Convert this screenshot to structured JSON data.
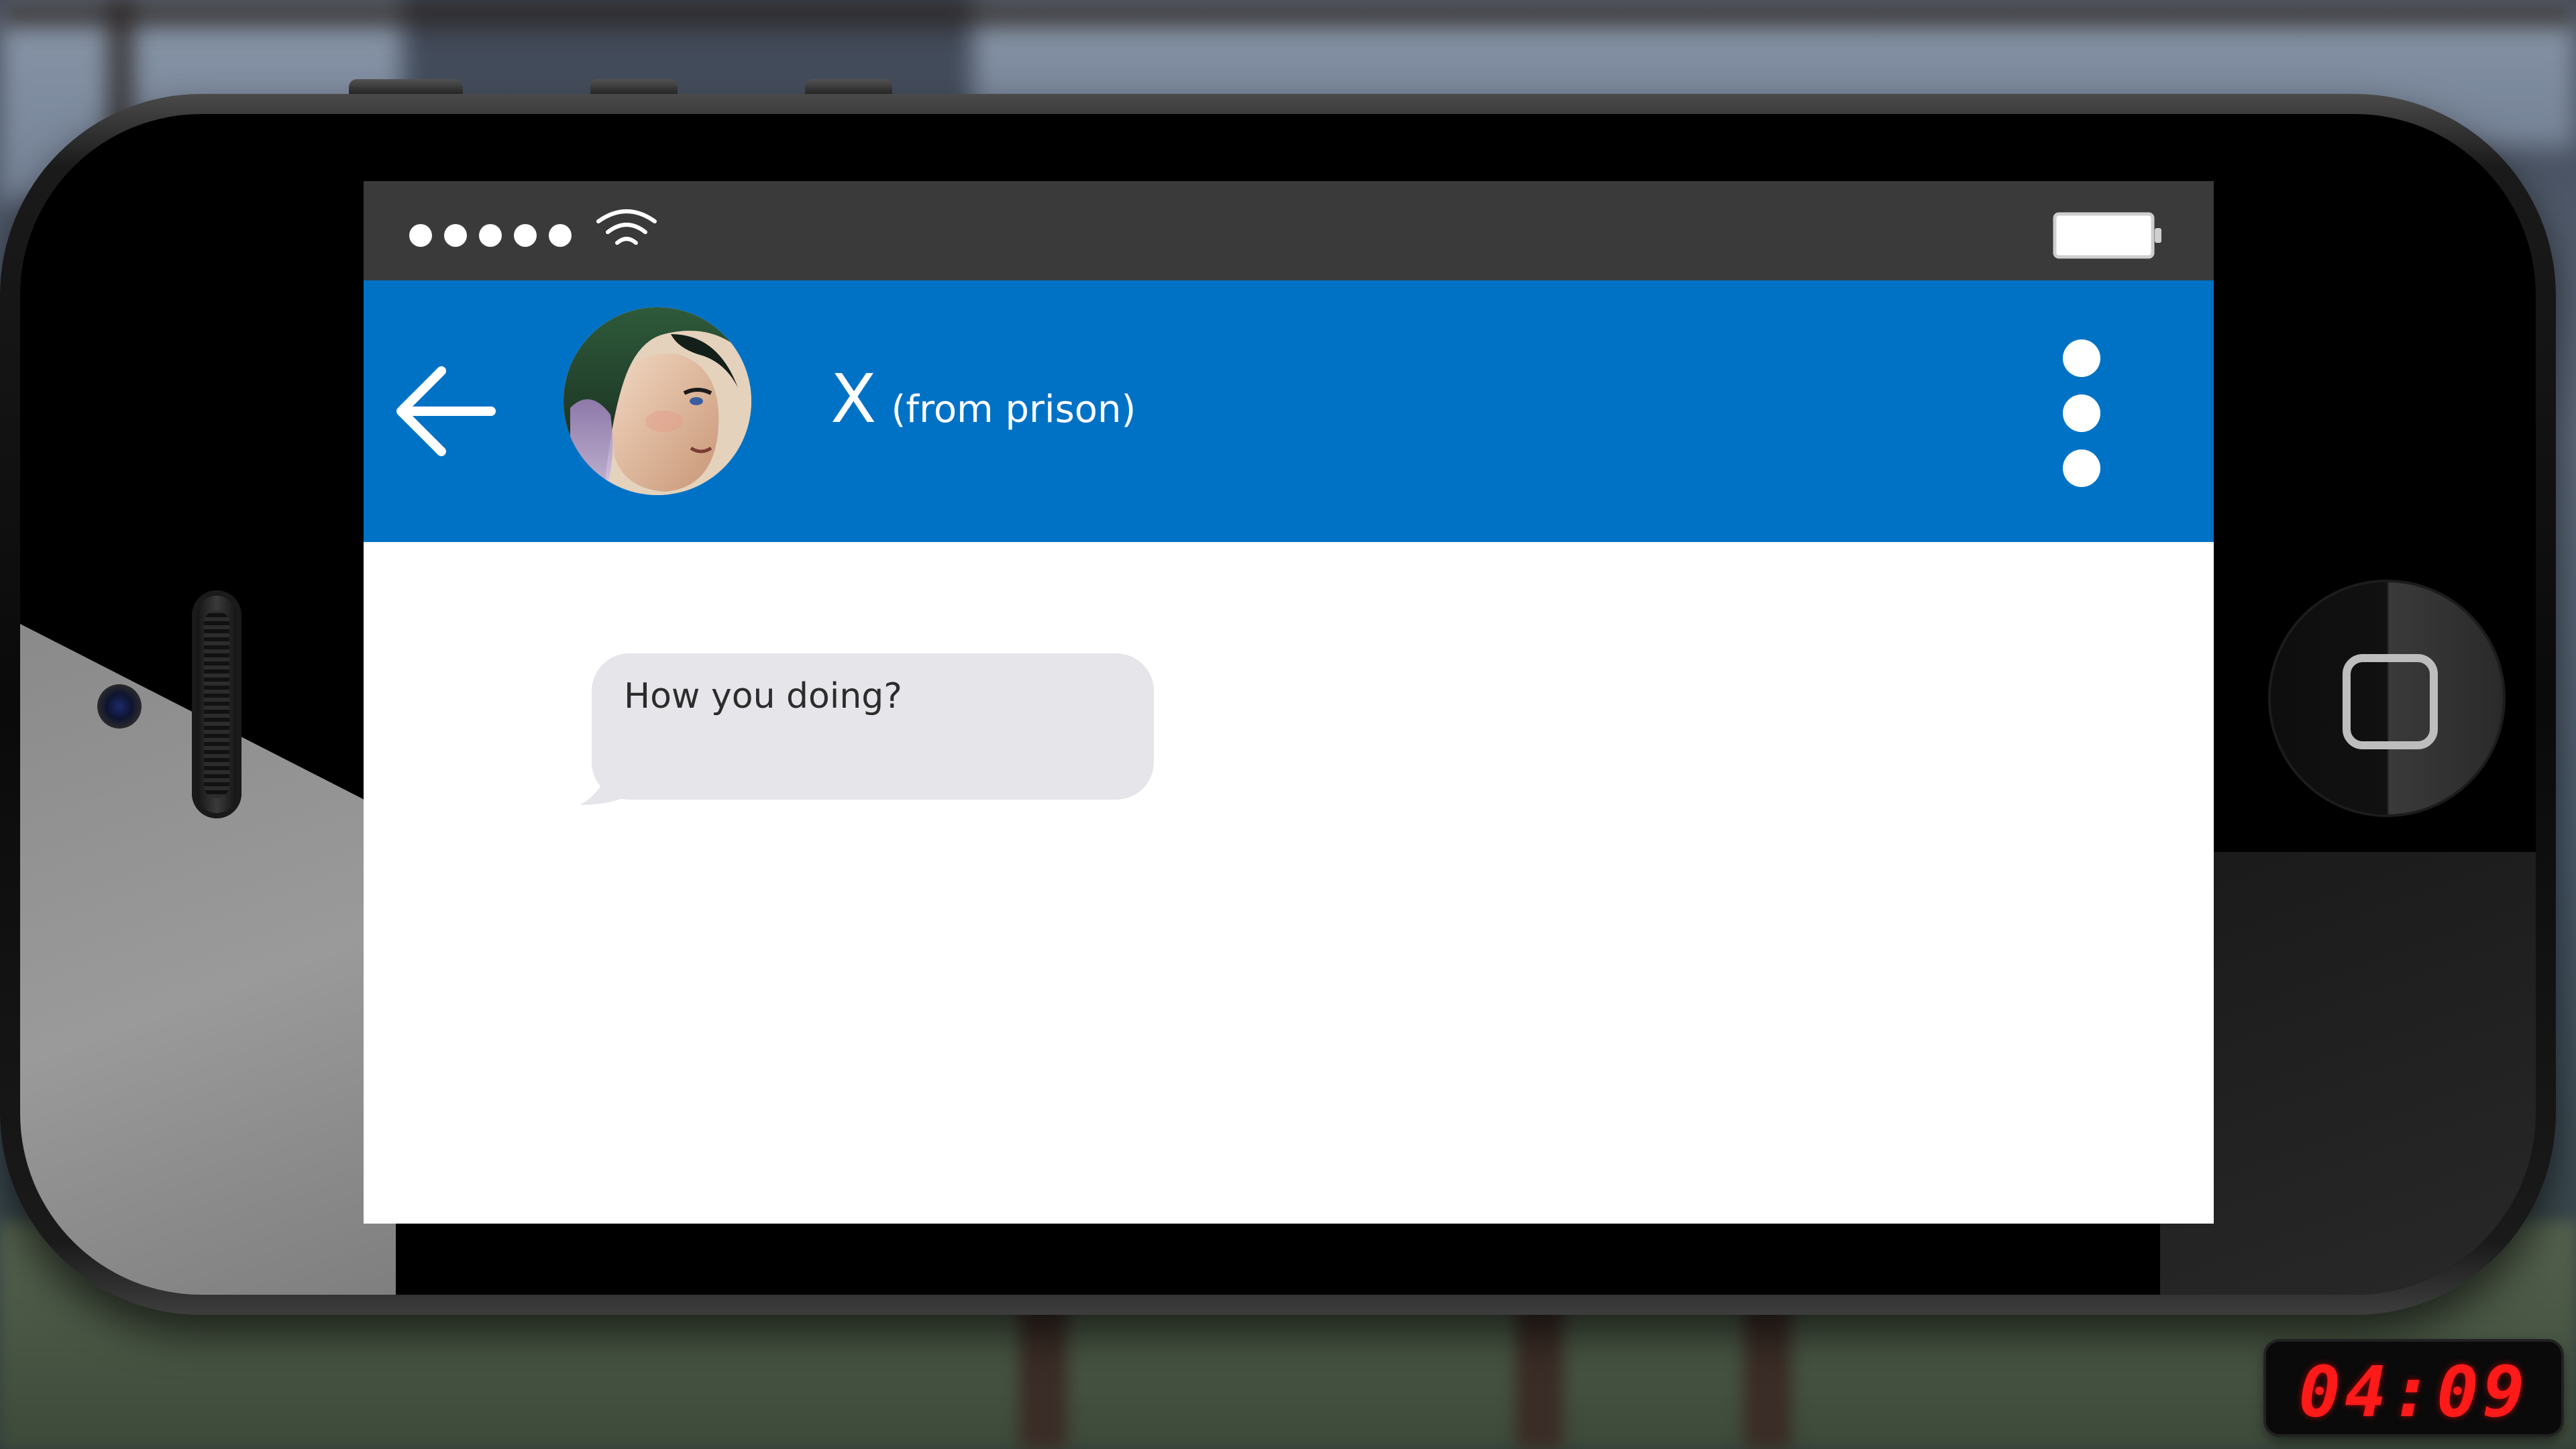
{
  "colors": {
    "header_blue": "#0072c6",
    "status_bar": "#3a3a3a",
    "bubble_gray": "#e5e5ea",
    "timer_red": "#ff1a1a"
  },
  "status_bar": {
    "signal_bars": 5,
    "wifi_icon": "wifi-icon",
    "battery_icon": "battery-icon",
    "battery_level": 1.0
  },
  "header": {
    "back_icon": "arrow-left-icon",
    "contact_name": "X",
    "contact_subtitle": "(from prison)",
    "menu_icon": "vertical-dots-icon"
  },
  "messages": [
    {
      "text": "How you doing?",
      "direction": "incoming"
    }
  ],
  "timer": {
    "value": "04:09"
  }
}
